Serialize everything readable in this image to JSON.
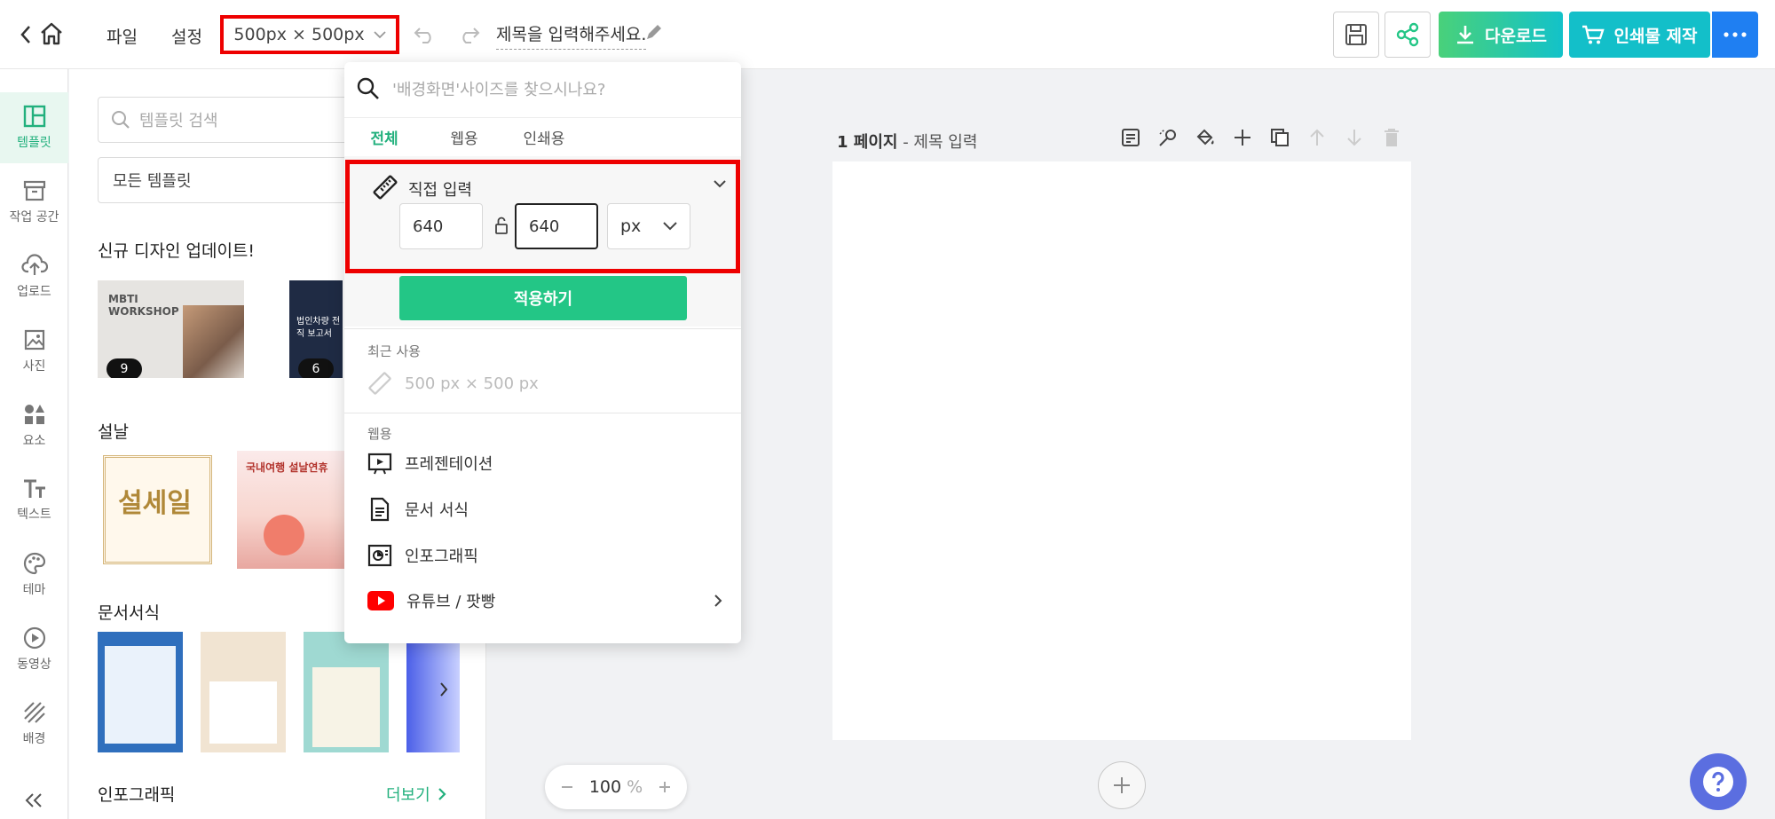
{
  "topbar": {
    "menu_file": "파일",
    "menu_settings": "설정",
    "size_label": "500px × 500px",
    "title_placeholder": "제목을 입력해주세요.",
    "download_label": "다운로드",
    "print_label": "인쇄물 제작"
  },
  "rail": {
    "items": [
      {
        "label": "템플릿",
        "icon": "template-icon"
      },
      {
        "label": "작업 공간",
        "icon": "workspace-icon"
      },
      {
        "label": "업로드",
        "icon": "upload-icon"
      },
      {
        "label": "사진",
        "icon": "photo-icon"
      },
      {
        "label": "요소",
        "icon": "elements-icon"
      },
      {
        "label": "텍스트",
        "icon": "text-icon"
      },
      {
        "label": "테마",
        "icon": "theme-icon"
      },
      {
        "label": "동영상",
        "icon": "video-icon"
      },
      {
        "label": "배경",
        "icon": "background-icon"
      }
    ]
  },
  "panel": {
    "search_placeholder": "템플릿 검색",
    "select_value": "모든 템플릿",
    "section_new": "신규 디자인 업데이트!",
    "section_lunar": "설날",
    "section_docs": "문서서식",
    "section_info": "인포그래픽",
    "more_label": "더보기",
    "thumb1_title": "MBTI WORKSHOP",
    "thumb1_count": "9",
    "thumb2_count": "6",
    "thumb2_text": "법인차량 전직 보고서",
    "lunar1_text": "설세일",
    "lunar2_text": "국내여행 설날연휴"
  },
  "canvas": {
    "page_number": "1 페이지",
    "page_title": "- 제목 입력",
    "zoom_value": "100",
    "zoom_unit": "%"
  },
  "dropdown": {
    "search_placeholder": "'배경화면'사이즈를 찾으시나요?",
    "tabs": [
      "전체",
      "웹용",
      "인쇄용"
    ],
    "custom_label": "직접 입력",
    "width_value": "640",
    "height_value": "640",
    "unit": "px",
    "apply_label": "적용하기",
    "recent_label": "최근 사용",
    "recent_item": "500 px × 500 px",
    "web_label": "웹용",
    "items": [
      "프레젠테이션",
      "문서 서식",
      "인포그래픽",
      "유튜브 / 팟빵"
    ]
  },
  "colors": {
    "accent_green": "#23c686",
    "accent_teal": "#13c2c9",
    "accent_blue": "#1f7ff2",
    "highlight_red": "#ee0000"
  }
}
